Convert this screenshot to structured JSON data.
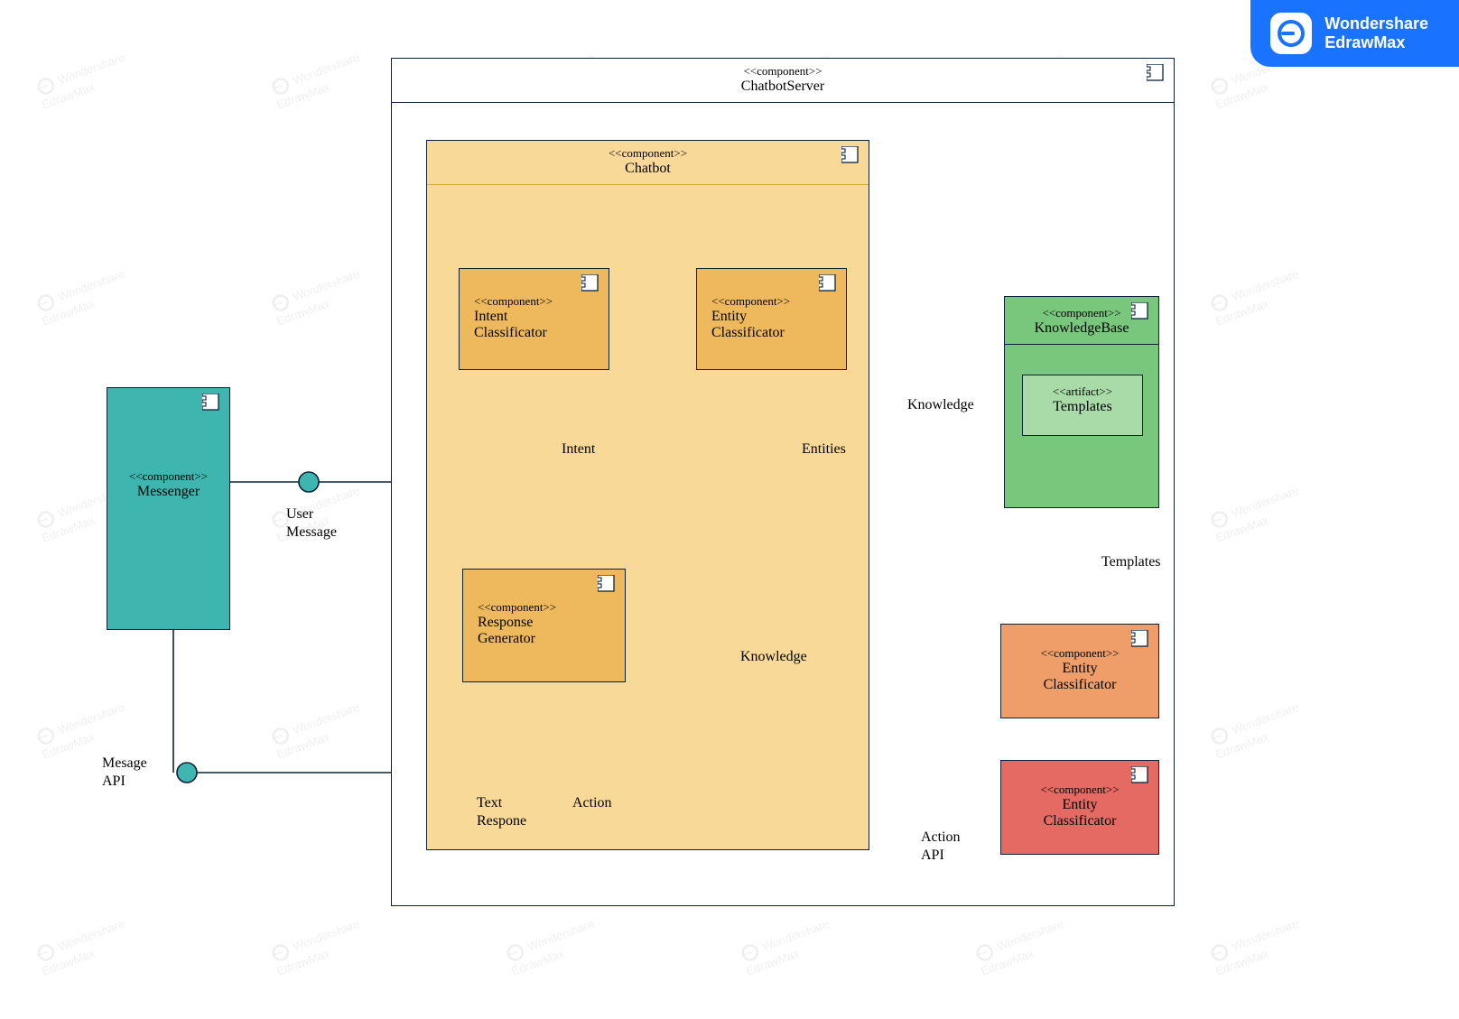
{
  "brand": {
    "line1": "Wondershare",
    "line2": "EdrawMax"
  },
  "watermark": {
    "line1": "Wondershare",
    "line2": "EdrawMax"
  },
  "stereo": {
    "component": "<<component>>",
    "artifact": "<<artifact>>"
  },
  "server": {
    "name": "ChatbotServer"
  },
  "chatbot": {
    "name": "Chatbot"
  },
  "intent": {
    "name": "Intent\nClassificator"
  },
  "entity": {
    "name": "Entity\nClassificator"
  },
  "resp": {
    "name": "Response\nGenerator"
  },
  "msgr": {
    "name": "Messenger"
  },
  "kb": {
    "name": "KnowledgeBase"
  },
  "tpl": {
    "name": "Templates"
  },
  "ec2": {
    "name": "Entity\nClassificator"
  },
  "ec3": {
    "name": "Entity\nClassificator"
  },
  "labels": {
    "userMessage": "User\nMessage",
    "intent": "Intent",
    "entities": "Entities",
    "knowledgeTop": "Knowledge",
    "knowledgeRight": "Knowledge",
    "templates": "Templates",
    "textResp": "Text\nRespone",
    "action": "Action",
    "mesageApi": "Mesage\nAPI",
    "actionApi": "Action\nAPI"
  },
  "colors": {
    "teal": "#3eb5ae",
    "orange": "#f9d489",
    "orangeD": "#eeb646",
    "green": "#79c77d",
    "greenL": "#a9dba9",
    "coral": "#ef9e69",
    "red": "#e46a63",
    "port": "#f4c34d",
    "portRed": "#e46a63",
    "portGreen": "#4dbb6f",
    "portTeal": "#3eb5ae"
  }
}
